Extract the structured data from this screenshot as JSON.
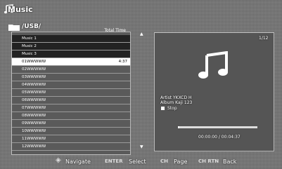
{
  "title": "Music",
  "path": "/USB/",
  "list_header": {
    "time": "Total Time"
  },
  "rows": [
    {
      "name": "Music 1",
      "time": "",
      "type": "folder"
    },
    {
      "name": "Music 2",
      "time": "",
      "type": "folder"
    },
    {
      "name": "Music 3",
      "time": "",
      "type": "folder"
    },
    {
      "name": "01WWWWW",
      "time": "4:37",
      "type": "file",
      "selected": true
    },
    {
      "name": "02WWWWW",
      "time": "",
      "type": "file"
    },
    {
      "name": "03WWWWW",
      "time": "",
      "type": "file"
    },
    {
      "name": "04WWWWW",
      "time": "",
      "type": "file"
    },
    {
      "name": "05WWWWW",
      "time": "",
      "type": "file"
    },
    {
      "name": "06WWWWW",
      "time": "",
      "type": "file"
    },
    {
      "name": "07WWWWW",
      "time": "",
      "type": "file"
    },
    {
      "name": "08WWWWW",
      "time": "",
      "type": "file"
    },
    {
      "name": "09WWWWW",
      "time": "",
      "type": "file"
    },
    {
      "name": "10WWWWW",
      "time": "",
      "type": "file"
    },
    {
      "name": "11WWWWW",
      "time": "",
      "type": "file"
    },
    {
      "name": "12WWWWW",
      "time": "",
      "type": "file"
    }
  ],
  "panel": {
    "counter": "1/12",
    "artist": "Artist   YKXCD H",
    "album": "Album   Kaji 123",
    "stop": "Stop",
    "progress": 0.02,
    "time": "00:00:00 / 00:04:37"
  },
  "bottom": {
    "navigate_key": "◈",
    "navigate": "Navigate",
    "select_key": "ENTER",
    "select": "Select",
    "page_key": "CH",
    "page": "Page",
    "back_key": "CH RTN",
    "back": "Back"
  },
  "colors": {
    "highlight": "#ffffff",
    "panel": "#555555"
  }
}
